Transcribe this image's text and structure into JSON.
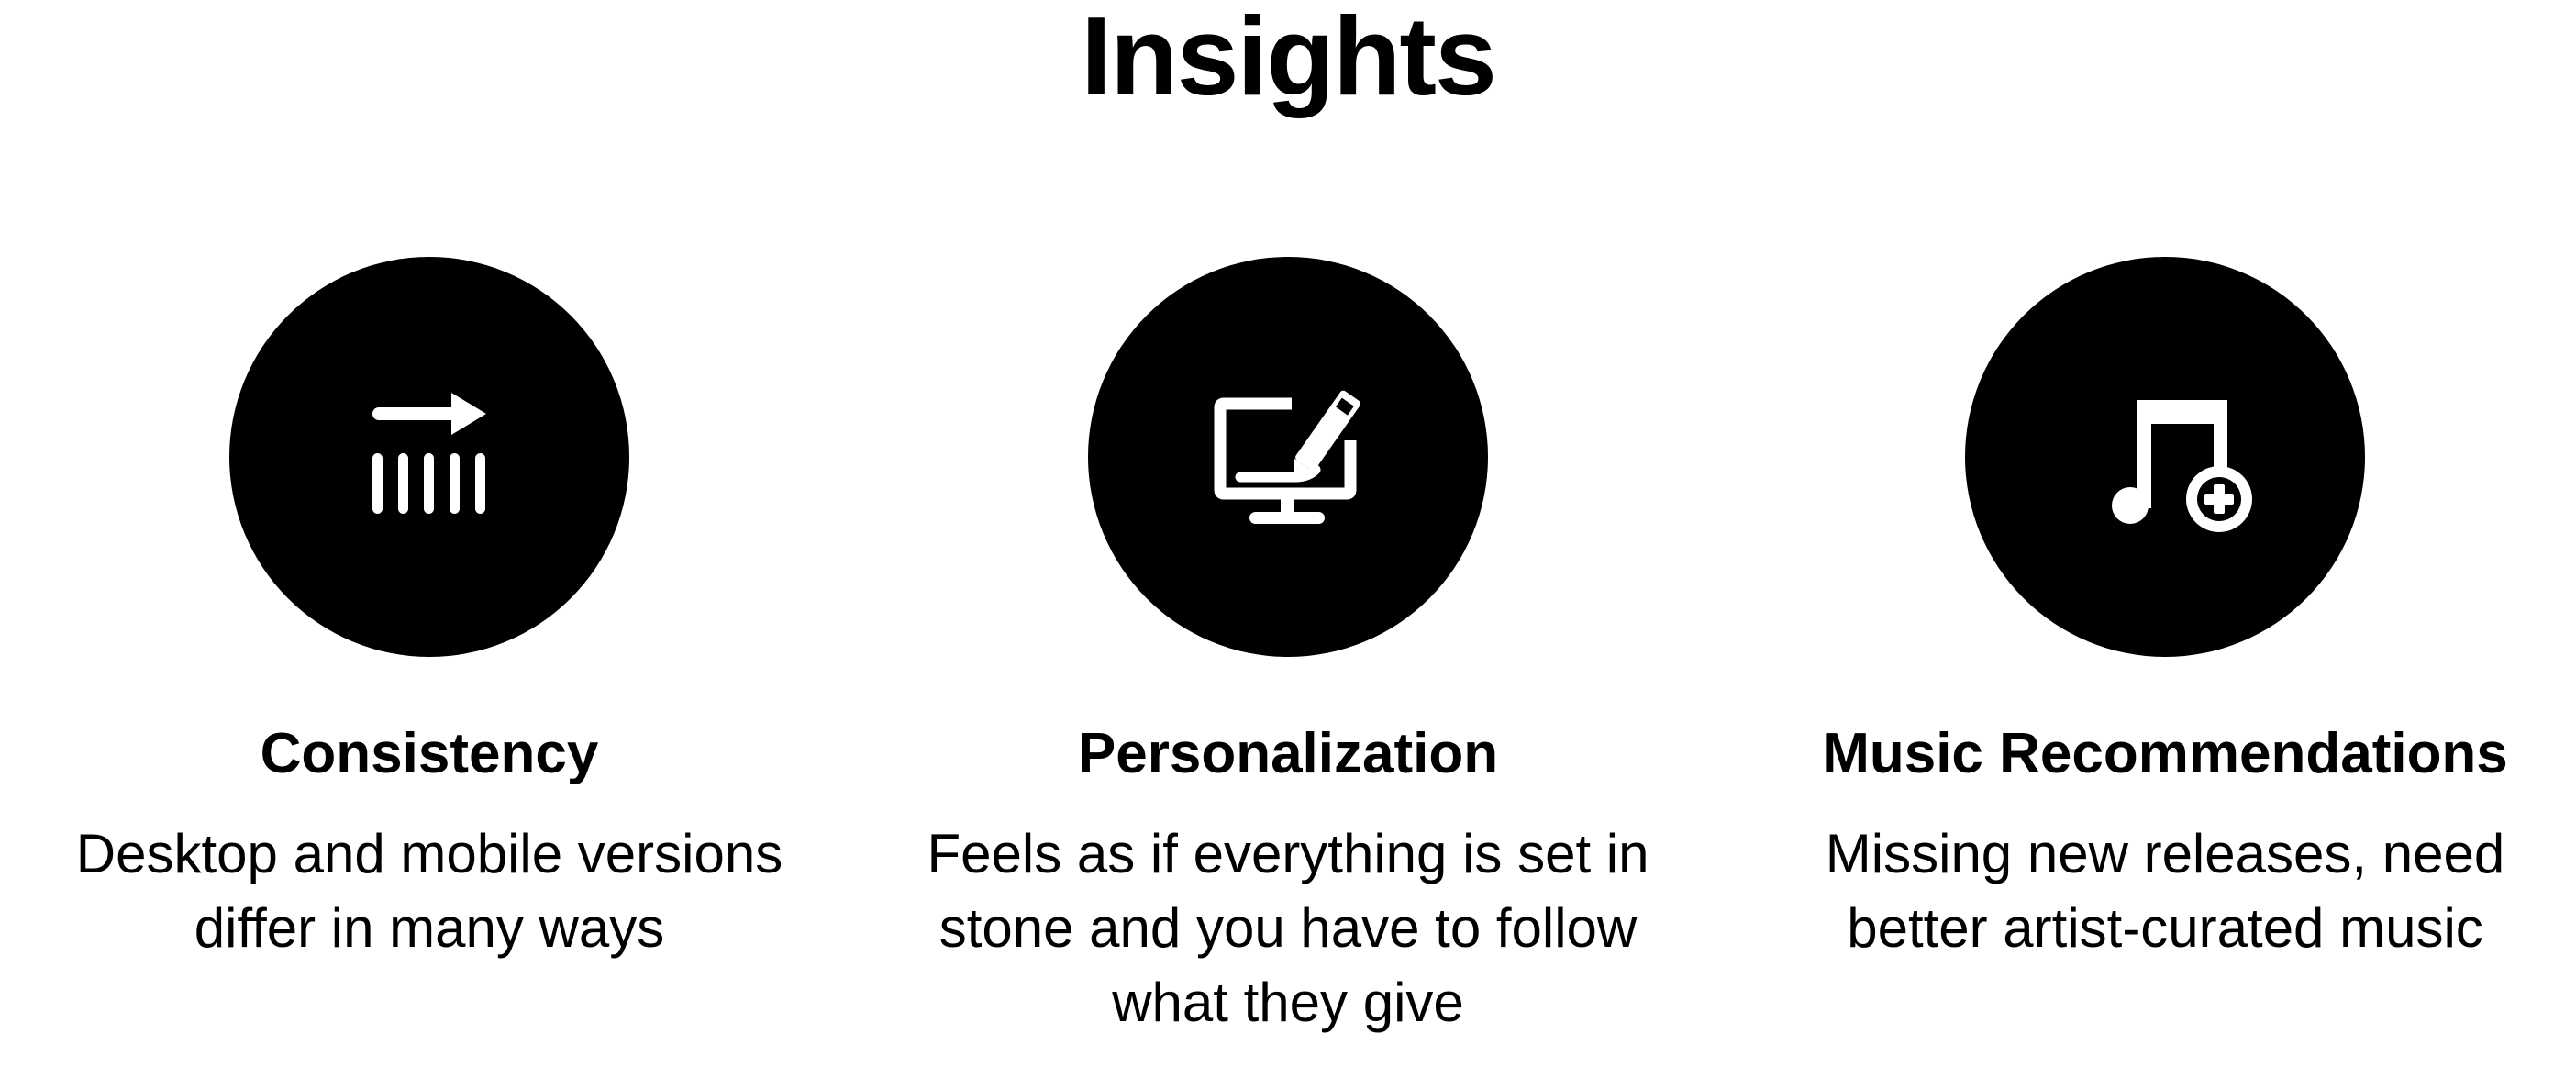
{
  "page": {
    "title": "Insights"
  },
  "insights": [
    {
      "icon": "arrow-over-bars-icon",
      "title": "Consistency",
      "text": "Desktop and mobile versions differ in many ways"
    },
    {
      "icon": "monitor-pen-icon",
      "title": "Personalization",
      "text": "Feels as if everything is set in stone and you have to follow what they give"
    },
    {
      "icon": "music-note-add-icon",
      "title": "Music Recommendations",
      "text": "Missing new releases, need better artist-curated music"
    }
  ],
  "colors": {
    "background": "#ffffff",
    "circle": "#000000",
    "icon": "#ffffff",
    "text": "#000000"
  }
}
